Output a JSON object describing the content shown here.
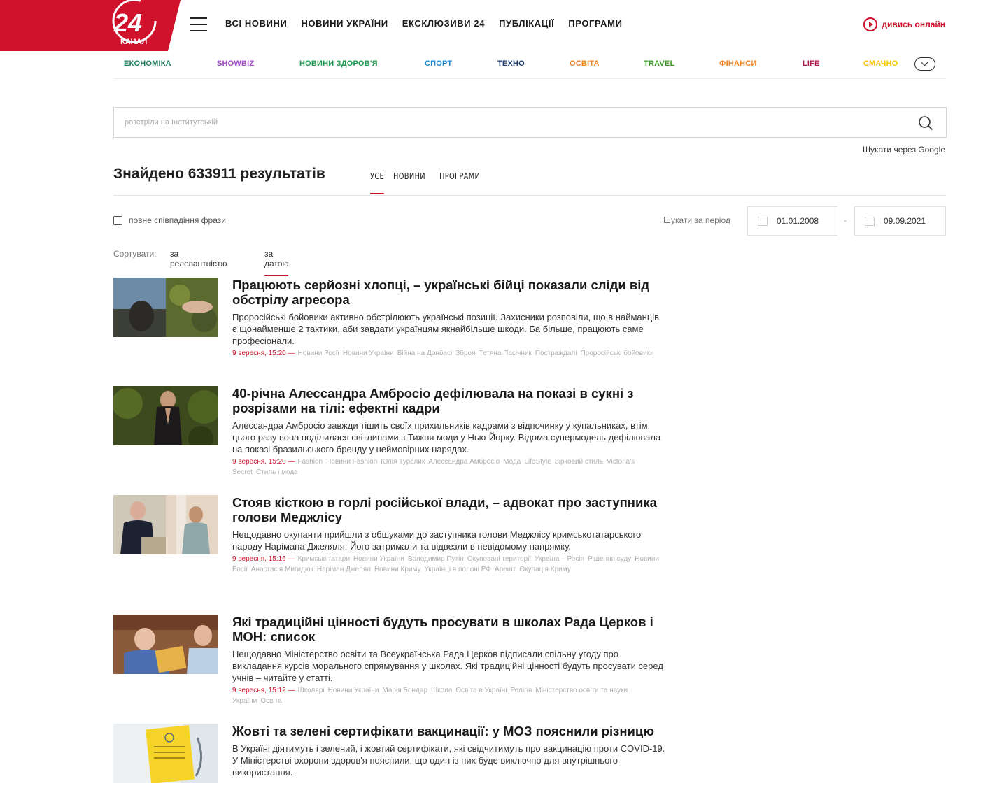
{
  "header": {
    "logo_number": "24",
    "logo_sub": "КАНАЛ",
    "nav": [
      "ВСІ НОВИНИ",
      "НОВИНИ УКРАЇНИ",
      "ЕКСКЛЮЗИВИ 24",
      "ПУБЛІКАЦІЇ",
      "ПРОГРАМИ"
    ],
    "watch_label": "дивись онлайн"
  },
  "categories": [
    {
      "label": "ЕКОНОМІКА",
      "color": "#1b7a5a"
    },
    {
      "label": "SHOWBIZ",
      "color": "#a046c8"
    },
    {
      "label": "НОВИНИ ЗДОРОВ'Я",
      "color": "#1e9a50"
    },
    {
      "label": "СПОРТ",
      "color": "#1a8ad4"
    },
    {
      "label": "ТЕХНО",
      "color": "#1f3a6e"
    },
    {
      "label": "ОСВІТА",
      "color": "#f07f1a"
    },
    {
      "label": "TRAVEL",
      "color": "#3e9a2a"
    },
    {
      "label": "ФІНАНСИ",
      "color": "#f0821e"
    },
    {
      "label": "LIFE",
      "color": "#b0124a"
    },
    {
      "label": "СМАЧНО",
      "color": "#f5c400"
    }
  ],
  "search": {
    "placeholder": "розстріли на Інститутській",
    "google_label": "Шукати через Google"
  },
  "results": {
    "found_text": "Знайдено 633911 результатів",
    "tabs": [
      "УСЕ",
      "НОВИНИ",
      "ПРОГРАМИ"
    ],
    "exact_label": "повне співпадіння фрази",
    "period_label": "Шукати за період",
    "date_from": "01.01.2008",
    "date_sep": "-",
    "date_to": "09.09.2021",
    "sort_label": "Сортувати:",
    "sort_relevance": "за релевантністю",
    "sort_date": "за датою"
  },
  "articles": [
    {
      "title": "Працюють серйозні хлопці, – українські бійці показали сліди від обстрілу агресора",
      "lead": "Проросійські бойовики активно обстрілюють українські позиції. Захисники розповіли, що в найманців є щонайменше 2 тактики, аби завдати українцям якнайбільше шкоди. Ба більше, працюють саме професіонали.",
      "date": "9 вересня, 15:20 —",
      "tags": [
        "Новини Росії",
        "Новини України",
        "Війна на Донбасі",
        "Зброя",
        "Тетяна Пасічник",
        "Постраждалі",
        "Проросійські бойовики"
      ]
    },
    {
      "title": "40-річна Алессандра Амбросіо дефілювала на показі в сукні з розрізами на тілі: ефектні кадри",
      "lead": "Алессандра Амбросіо завжди тішить своїх прихильників кадрами з відпочинку у купальниках, втім цього разу вона поділилася світлинами з Тижня моди у Нью-Йорку. Відома супермодель дефілювала на показі бразильського бренду у неймовірних нарядах.",
      "date": "9 вересня, 15:20 —",
      "tags": [
        "Fashion",
        "Новини Fashion",
        "Юлія Турелик",
        "Алессандра Амбросіо",
        "Мода",
        "LifeStyle",
        "Зірковий стиль",
        "Victoria's Secret",
        "Стиль і мода"
      ]
    },
    {
      "title": "Стояв кісткою в горлі російської влади, – адвокат про заступника голови Меджлісу",
      "lead": "Нещодавно окупанти прийшли з обшуками до заступника голови Меджлісу кримськотатарського народу Нарімана Джеляля. Його затримали та відвезли в невідомому напрямку.",
      "date": "9 вересня, 15:16 —",
      "tags": [
        "Кримські татари",
        "Новини України",
        "Володимир Путін",
        "Окуповані території",
        "Україна – Росія",
        "Рішення суду",
        "Новини Росії",
        "Анастасія Мигидюк",
        "Наріман Джелял",
        "Новини Криму",
        "Українці в полоні РФ",
        "Арешт",
        "Окупація Криму"
      ]
    },
    {
      "title": "Які традиційні цінності будуть просувати в школах Рада Церков і МОН: список",
      "lead": "Нещодавно Міністерство освіти та Всеукраїнська Рада Церков підписали спільну угоду про викладання курсів морального спрямування у школах. Які традиційні цінності будуть просувати серед учнів – читайте у статті.",
      "date": "9 вересня, 15:12 —",
      "tags": [
        "Школярі",
        "Новини України",
        "Марія Бондар",
        "Школа",
        "Освіта в Україні",
        "Релігія",
        "Міністерство освіти та науки України",
        "Освіта"
      ]
    },
    {
      "title": "Жовті та зелені сертифікати вакцинації: у МОЗ пояснили різницю",
      "lead": "В Україні діятимуть і зелений, і жовтий сертифікати, які свідчитимуть про вакцинацію проти COVID-19. У Міністерстві охорони здоров'я пояснили, що один із них буде виключно для внутрішнього використання.",
      "date": "",
      "tags": []
    }
  ],
  "colors": {
    "accent": "#d0112b"
  }
}
